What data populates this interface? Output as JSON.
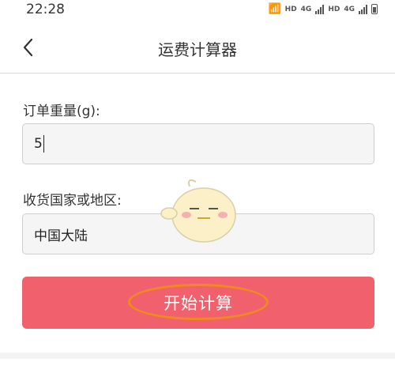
{
  "status_bar": {
    "time": "22:28",
    "net1": "HD",
    "gen1": "4G",
    "net2": "HD",
    "gen2": "4G"
  },
  "nav": {
    "title": "运费计算器",
    "back_icon": "chevron-left-icon"
  },
  "form": {
    "weight": {
      "label": "订单重量(g):",
      "value": "5"
    },
    "country": {
      "label": "收货国家或地区:",
      "value": "中国大陆"
    },
    "submit_label": "开始计算"
  },
  "colors": {
    "accent": "#f0616d",
    "highlight": "#f08a1e"
  }
}
